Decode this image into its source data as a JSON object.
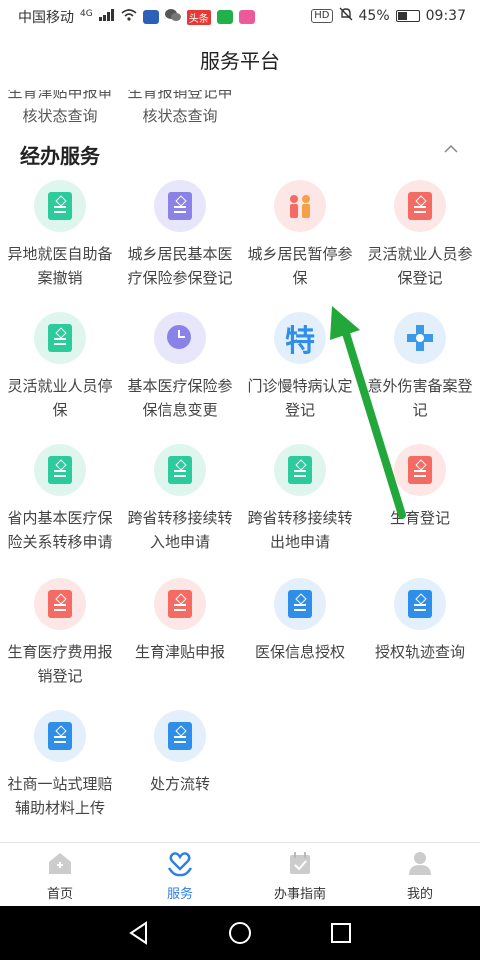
{
  "status_bar": {
    "carrier": "中国移动",
    "network": "4G",
    "news_badge": "头条",
    "hd": "HD",
    "battery": "45%",
    "time": "09:37"
  },
  "header": {
    "title": "服务平台"
  },
  "prev_row": {
    "items": [
      "生育津贴申报审核状态查询",
      "生育报销登记申核状态查询"
    ],
    "line1": [
      "生育津贴申报审",
      "生育报销登记申"
    ],
    "line2": [
      "核状态查询",
      "核状态查询"
    ]
  },
  "section": {
    "title": "经办服务"
  },
  "services": [
    {
      "line1": "异地就医自助备",
      "line2": "案撤销",
      "icon": "document-icon",
      "color": "green"
    },
    {
      "line1": "城乡居民基本医",
      "line2": "疗保险参保登记",
      "icon": "edit-document-icon",
      "color": "purple"
    },
    {
      "line1": "城乡居民暂停参",
      "line2": "保",
      "icon": "people-icon",
      "color": "pink"
    },
    {
      "line1": "灵活就业人员参",
      "line2": "保登记",
      "icon": "yuan-document-icon",
      "color": "pink"
    },
    {
      "line1": "灵活就业人员停",
      "line2": "保",
      "icon": "document-icon",
      "color": "green"
    },
    {
      "line1": "基本医疗保险参",
      "line2": "保信息变更",
      "icon": "clock-icon",
      "color": "purple"
    },
    {
      "line1": "门诊慢特病认定",
      "line2": "登记",
      "icon": "te-character-icon",
      "color": "blue",
      "glyph_text": "特"
    },
    {
      "line1": "意外伤害备案登",
      "line2": "记",
      "icon": "medical-cross-icon",
      "color": "blue"
    },
    {
      "line1": "省内基本医疗保",
      "line2": "险关系转移申请",
      "icon": "document-icon",
      "color": "green"
    },
    {
      "line1": "跨省转移接续转",
      "line2": "入地申请",
      "icon": "document-icon",
      "color": "green"
    },
    {
      "line1": "跨省转移接续转",
      "line2": "出地申请",
      "icon": "document-icon",
      "color": "green"
    },
    {
      "line1": "生育登记",
      "line2": "",
      "icon": "yuan-document-icon",
      "color": "pink"
    },
    {
      "line1": "生育医疗费用报",
      "line2": "销登记",
      "icon": "yuan-document-icon",
      "color": "pink"
    },
    {
      "line1": "生育津贴申报",
      "line2": "",
      "icon": "yuan-document-icon",
      "color": "pink"
    },
    {
      "line1": "医保信息授权",
      "line2": "",
      "icon": "list-document-icon",
      "color": "blue"
    },
    {
      "line1": "授权轨迹查询",
      "line2": "",
      "icon": "list-document-icon",
      "color": "blue"
    },
    {
      "line1": "社商一站式理赔",
      "line2": "辅助材料上传",
      "icon": "list-document-icon",
      "color": "blue"
    },
    {
      "line1": "处方流转",
      "line2": "",
      "icon": "list-document-icon",
      "color": "blue"
    }
  ],
  "bottom_nav": [
    {
      "label": "首页",
      "icon": "home-icon",
      "active": false
    },
    {
      "label": "服务",
      "icon": "heart-hand-icon",
      "active": true
    },
    {
      "label": "办事指南",
      "icon": "calendar-check-icon",
      "active": false
    },
    {
      "label": "我的",
      "icon": "person-icon",
      "active": false
    }
  ],
  "colors": {
    "green_bg": "#dff6ef",
    "green": "#2ccb9c",
    "purple_bg": "#e7e6fb",
    "purple": "#8a82e6",
    "pink_bg": "#fde7e6",
    "red": "#f36b62",
    "blue_bg": "#e3f0fc",
    "blue": "#2f8ee8",
    "active_tab": "#2f7ee8",
    "annotation_arrow": "#22a83a"
  }
}
